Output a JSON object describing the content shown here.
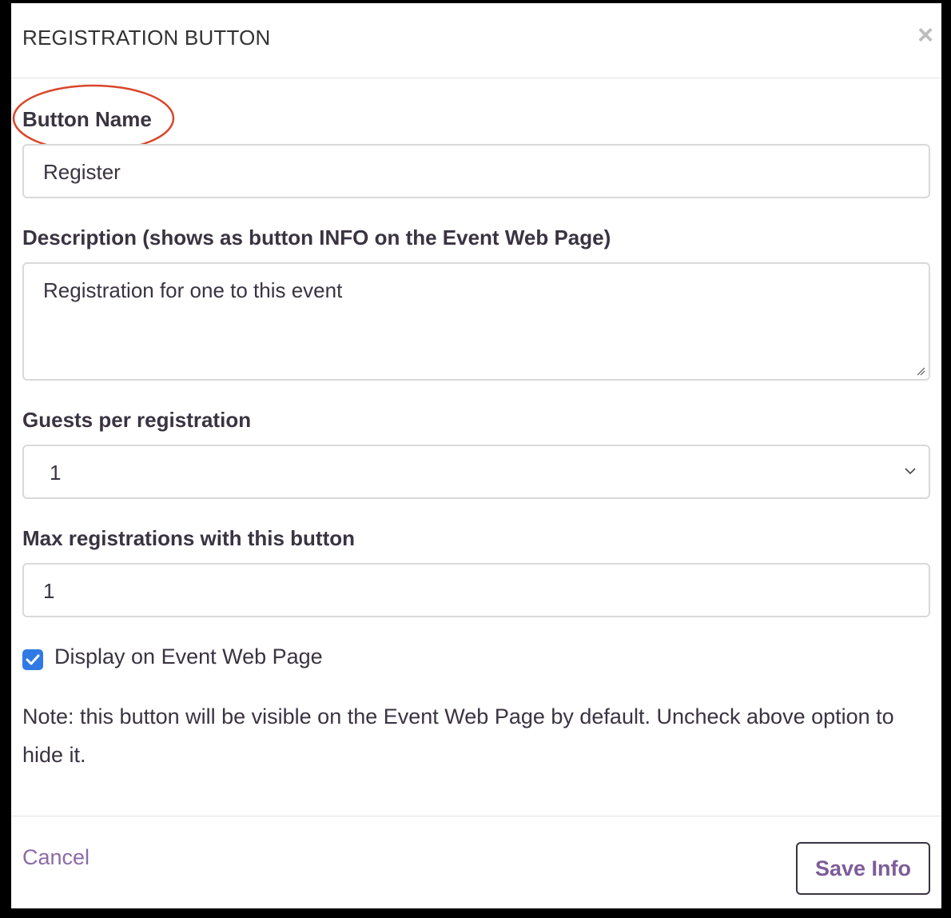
{
  "modal": {
    "title": "REGISTRATION BUTTON",
    "close_icon": "close-icon"
  },
  "fields": {
    "button_name": {
      "label": "Button Name",
      "value": "Register"
    },
    "description": {
      "label": "Description (shows as button INFO on the Event Web Page)",
      "value": "Registration for one to this event"
    },
    "guests": {
      "label": "Guests per registration",
      "selected": "1"
    },
    "max_registrations": {
      "label": "Max registrations with this button",
      "value": "1"
    }
  },
  "display_checkbox": {
    "label": "Display on Event Web Page",
    "checked": true
  },
  "note": "Note: this button will be visible on the Event Web Page by default. Uncheck above option to hide it.",
  "footer": {
    "cancel_label": "Cancel",
    "save_label": "Save Info"
  },
  "colors": {
    "accent_purple": "#8c6ba6",
    "checkbox_blue": "#2f7ae5",
    "annotation_red": "#d9472b",
    "text_dark": "#3a3341"
  }
}
